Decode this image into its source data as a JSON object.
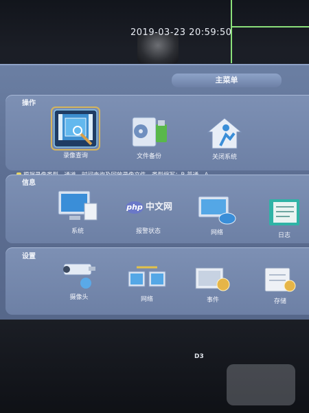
{
  "overlay": {
    "timestamp": "2019-03-23 20:59:50",
    "camera_id": "D3"
  },
  "menu": {
    "title": "主菜单",
    "sections": {
      "operations": {
        "label": "操作",
        "items": [
          {
            "label": "录像查询",
            "icon": "video-search-icon",
            "selected": true
          },
          {
            "label": "文件备份",
            "icon": "file-backup-icon"
          },
          {
            "label": "关闭系统",
            "icon": "shutdown-icon"
          }
        ],
        "hint": "根据录像类型、通道、时间查询及回放录像文件，类型缩写：R-普通、A"
      },
      "info": {
        "label": "信息",
        "items": [
          {
            "label": "系统",
            "icon": "system-info-icon"
          },
          {
            "label": "报警状态",
            "icon": "alarm-status-icon"
          },
          {
            "label": "网络",
            "icon": "network-info-icon"
          },
          {
            "label": "日志",
            "icon": "log-icon"
          }
        ]
      },
      "settings": {
        "label": "设置",
        "items": [
          {
            "label": "摄像头",
            "icon": "camera-icon"
          },
          {
            "label": "网络",
            "icon": "network-settings-icon"
          },
          {
            "label": "事件",
            "icon": "event-icon"
          },
          {
            "label": "存储",
            "icon": "storage-icon"
          }
        ]
      }
    }
  },
  "watermark": {
    "badge": "php",
    "text": "中文网"
  },
  "colors": {
    "menu_bg": "#6b7fa3",
    "section_bg": "#7d90b4",
    "selection": "#d6b55b",
    "line_green": "#8be07a"
  }
}
